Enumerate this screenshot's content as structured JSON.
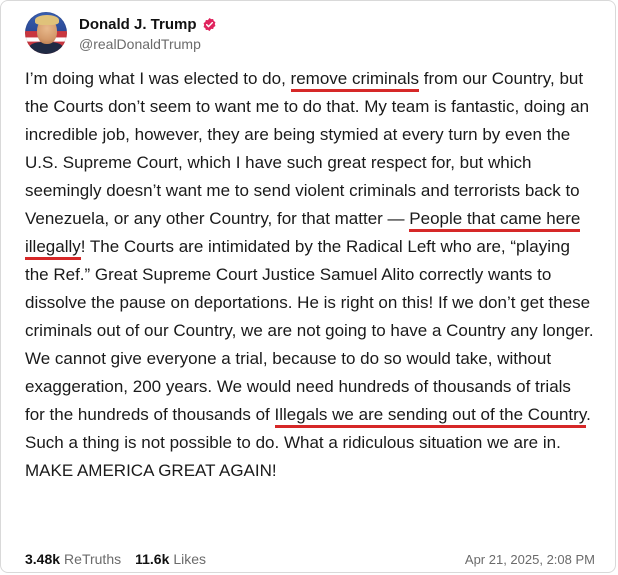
{
  "author": {
    "display_name": "Donald J. Trump",
    "handle": "@realDonaldTrump",
    "verified_color": "#e0245e"
  },
  "post": {
    "segments": [
      {
        "text": "I’m doing what I was elected to do, ",
        "highlight": false
      },
      {
        "text": "remove criminals",
        "highlight": true
      },
      {
        "text": " from our Country, but the Courts don’t seem to want me to do that. My team is fantastic, doing an incredible job, however, they are being stymied at every turn by even the U.S. Supreme Court, which I have such great respect for, but which seemingly doesn’t want me to send violent criminals and terrorists back to Venezuela, or any other Country, for that matter — ",
        "highlight": false
      },
      {
        "text": "People that came here illegally",
        "highlight": true
      },
      {
        "text": "! The Courts are intimidated by the Radical Left who are, “playing the Ref.” Great Supreme Court Justice Samuel Alito correctly wants to dissolve the pause on deportations. He is right on this! If we don’t get these criminals out of our Country, we are not going to have a Country any longer. We cannot give everyone a trial, because to do so would take, without exaggeration, 200 years. We would need hundreds of thousands of trials for the hundreds of thousands of ",
        "highlight": false
      },
      {
        "text": "Illegals we are sending out of the Country",
        "highlight": true
      },
      {
        "text": ". Such a thing is not possible to do. What a ridiculous situation we are in. MAKE AMERICA GREAT AGAIN!",
        "highlight": false
      }
    ],
    "highlight_color": "#d62828"
  },
  "footer": {
    "retruths_count": "3.48k",
    "retruths_label": "ReTruths",
    "likes_count": "11.6k",
    "likes_label": "Likes",
    "timestamp": "Apr 21, 2025, 2:08 PM"
  }
}
